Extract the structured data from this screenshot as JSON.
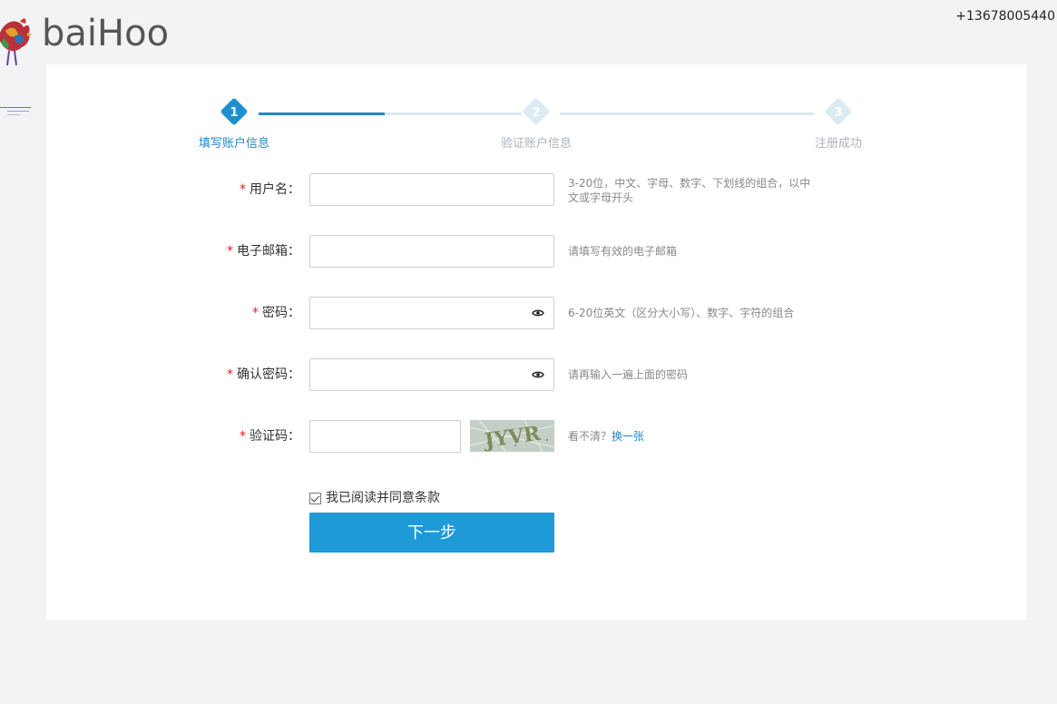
{
  "header": {
    "logo_text": "baiHoo",
    "phone": "+13678005440"
  },
  "steps": [
    {
      "number": "1",
      "label": "填写账户信息",
      "state": "active"
    },
    {
      "number": "2",
      "label": "验证账户信息",
      "state": "todo"
    },
    {
      "number": "3",
      "label": "注册成功",
      "state": "todo"
    }
  ],
  "progress": {
    "completed_fraction_of_first_segment": 0.5
  },
  "form": {
    "required_mark": "*",
    "username": {
      "label": "用户名：",
      "value": "",
      "hint": "3-20位，中文、字母、数字、下划线的组合，以中文或字母开头"
    },
    "email": {
      "label": "电子邮箱：",
      "value": "",
      "hint": "请填写有效的电子邮箱"
    },
    "password": {
      "label": "密码：",
      "value": "",
      "hint": "6-20位英文（区分大小写）、数字、字符的组合"
    },
    "confirm_password": {
      "label": "确认密码：",
      "value": "",
      "hint": "请再输入一遍上面的密码"
    },
    "captcha": {
      "label": "验证码：",
      "value": "",
      "hint_prefix": "看不清？",
      "refresh_link": "换一张",
      "image_text": "JYVR"
    },
    "agree_label": "我已阅读并同意条款",
    "agree_checked": true,
    "next_button": "下一步"
  },
  "colors": {
    "accent": "#1e88c8",
    "button": "#1e9ad6",
    "required": "#e02020",
    "page_bg": "#f3f3f5"
  },
  "icons": {
    "password_toggle": "eye-icon",
    "logo": "rooster-logo"
  }
}
